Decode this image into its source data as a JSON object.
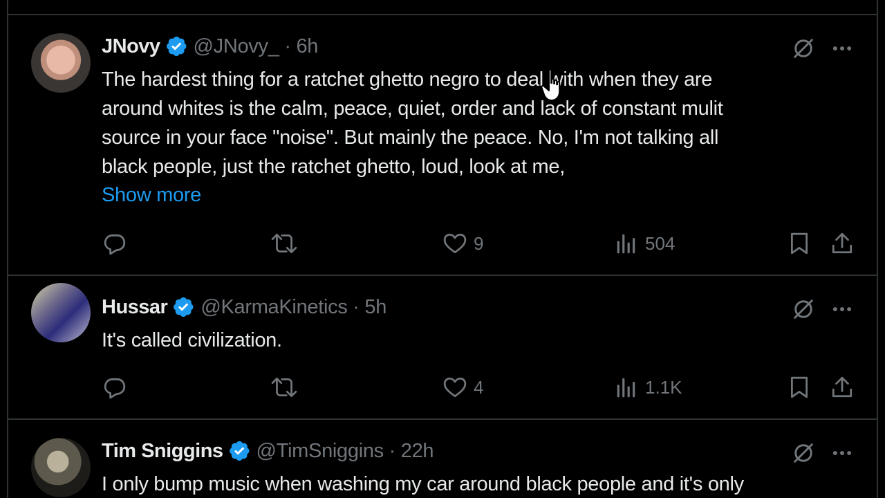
{
  "tweets": [
    {
      "name": "JNovy",
      "handle_time": "@JNovy_ · 6h",
      "text_lines": [
        "The hardest thing for a ratchet ghetto negro to deal with when they are",
        "around whites is the calm, peace, quiet, order and lack of constant mulit",
        "source in your face \"noise\". But mainly the peace.  No, I'm not talking all",
        "black people, just the ratchet ghetto, loud, look at me,"
      ],
      "show_more": "Show more",
      "likes": "9",
      "views": "504"
    },
    {
      "name": "Hussar",
      "handle_time": "@KarmaKinetics · 5h",
      "text_lines": [
        "It's called civilization."
      ],
      "likes": "4",
      "views": "1.1K"
    },
    {
      "name": "Tim Sniggins",
      "handle_time": "@TimSniggins · 22h",
      "text_lines": [
        "I only bump music when washing my car around black people and it's only"
      ]
    }
  ],
  "icons": {
    "verified": "verified-badge-icon",
    "grok": "grok-icon",
    "more": "more-icon",
    "reply": "reply-icon",
    "retweet": "retweet-icon",
    "like": "heart-icon",
    "views": "views-icon",
    "bookmark": "bookmark-icon",
    "share": "share-icon"
  },
  "colors": {
    "background": "#000000",
    "text": "#e7e9ea",
    "muted": "#71767b",
    "accent": "#1d9bf0",
    "divider": "#2f3336"
  }
}
